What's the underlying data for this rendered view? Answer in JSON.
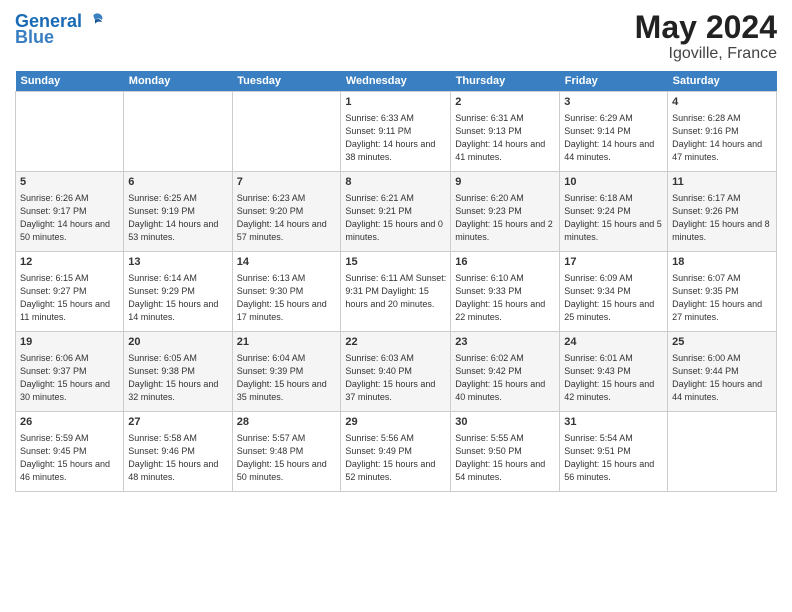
{
  "header": {
    "logo_general": "General",
    "logo_blue": "Blue",
    "month_year": "May 2024",
    "location": "Igoville, France"
  },
  "days_of_week": [
    "Sunday",
    "Monday",
    "Tuesday",
    "Wednesday",
    "Thursday",
    "Friday",
    "Saturday"
  ],
  "weeks": [
    [
      {
        "day": "",
        "info": ""
      },
      {
        "day": "",
        "info": ""
      },
      {
        "day": "",
        "info": ""
      },
      {
        "day": "1",
        "info": "Sunrise: 6:33 AM\nSunset: 9:11 PM\nDaylight: 14 hours\nand 38 minutes."
      },
      {
        "day": "2",
        "info": "Sunrise: 6:31 AM\nSunset: 9:13 PM\nDaylight: 14 hours\nand 41 minutes."
      },
      {
        "day": "3",
        "info": "Sunrise: 6:29 AM\nSunset: 9:14 PM\nDaylight: 14 hours\nand 44 minutes."
      },
      {
        "day": "4",
        "info": "Sunrise: 6:28 AM\nSunset: 9:16 PM\nDaylight: 14 hours\nand 47 minutes."
      }
    ],
    [
      {
        "day": "5",
        "info": "Sunrise: 6:26 AM\nSunset: 9:17 PM\nDaylight: 14 hours\nand 50 minutes."
      },
      {
        "day": "6",
        "info": "Sunrise: 6:25 AM\nSunset: 9:19 PM\nDaylight: 14 hours\nand 53 minutes."
      },
      {
        "day": "7",
        "info": "Sunrise: 6:23 AM\nSunset: 9:20 PM\nDaylight: 14 hours\nand 57 minutes."
      },
      {
        "day": "8",
        "info": "Sunrise: 6:21 AM\nSunset: 9:21 PM\nDaylight: 15 hours\nand 0 minutes."
      },
      {
        "day": "9",
        "info": "Sunrise: 6:20 AM\nSunset: 9:23 PM\nDaylight: 15 hours\nand 2 minutes."
      },
      {
        "day": "10",
        "info": "Sunrise: 6:18 AM\nSunset: 9:24 PM\nDaylight: 15 hours\nand 5 minutes."
      },
      {
        "day": "11",
        "info": "Sunrise: 6:17 AM\nSunset: 9:26 PM\nDaylight: 15 hours\nand 8 minutes."
      }
    ],
    [
      {
        "day": "12",
        "info": "Sunrise: 6:15 AM\nSunset: 9:27 PM\nDaylight: 15 hours\nand 11 minutes."
      },
      {
        "day": "13",
        "info": "Sunrise: 6:14 AM\nSunset: 9:29 PM\nDaylight: 15 hours\nand 14 minutes."
      },
      {
        "day": "14",
        "info": "Sunrise: 6:13 AM\nSunset: 9:30 PM\nDaylight: 15 hours\nand 17 minutes."
      },
      {
        "day": "15",
        "info": "Sunrise: 6:11 AM\nSunset: 9:31 PM\nDaylight: 15 hours\nand 20 minutes."
      },
      {
        "day": "16",
        "info": "Sunrise: 6:10 AM\nSunset: 9:33 PM\nDaylight: 15 hours\nand 22 minutes."
      },
      {
        "day": "17",
        "info": "Sunrise: 6:09 AM\nSunset: 9:34 PM\nDaylight: 15 hours\nand 25 minutes."
      },
      {
        "day": "18",
        "info": "Sunrise: 6:07 AM\nSunset: 9:35 PM\nDaylight: 15 hours\nand 27 minutes."
      }
    ],
    [
      {
        "day": "19",
        "info": "Sunrise: 6:06 AM\nSunset: 9:37 PM\nDaylight: 15 hours\nand 30 minutes."
      },
      {
        "day": "20",
        "info": "Sunrise: 6:05 AM\nSunset: 9:38 PM\nDaylight: 15 hours\nand 32 minutes."
      },
      {
        "day": "21",
        "info": "Sunrise: 6:04 AM\nSunset: 9:39 PM\nDaylight: 15 hours\nand 35 minutes."
      },
      {
        "day": "22",
        "info": "Sunrise: 6:03 AM\nSunset: 9:40 PM\nDaylight: 15 hours\nand 37 minutes."
      },
      {
        "day": "23",
        "info": "Sunrise: 6:02 AM\nSunset: 9:42 PM\nDaylight: 15 hours\nand 40 minutes."
      },
      {
        "day": "24",
        "info": "Sunrise: 6:01 AM\nSunset: 9:43 PM\nDaylight: 15 hours\nand 42 minutes."
      },
      {
        "day": "25",
        "info": "Sunrise: 6:00 AM\nSunset: 9:44 PM\nDaylight: 15 hours\nand 44 minutes."
      }
    ],
    [
      {
        "day": "26",
        "info": "Sunrise: 5:59 AM\nSunset: 9:45 PM\nDaylight: 15 hours\nand 46 minutes."
      },
      {
        "day": "27",
        "info": "Sunrise: 5:58 AM\nSunset: 9:46 PM\nDaylight: 15 hours\nand 48 minutes."
      },
      {
        "day": "28",
        "info": "Sunrise: 5:57 AM\nSunset: 9:48 PM\nDaylight: 15 hours\nand 50 minutes."
      },
      {
        "day": "29",
        "info": "Sunrise: 5:56 AM\nSunset: 9:49 PM\nDaylight: 15 hours\nand 52 minutes."
      },
      {
        "day": "30",
        "info": "Sunrise: 5:55 AM\nSunset: 9:50 PM\nDaylight: 15 hours\nand 54 minutes."
      },
      {
        "day": "31",
        "info": "Sunrise: 5:54 AM\nSunset: 9:51 PM\nDaylight: 15 hours\nand 56 minutes."
      },
      {
        "day": "",
        "info": ""
      }
    ]
  ]
}
